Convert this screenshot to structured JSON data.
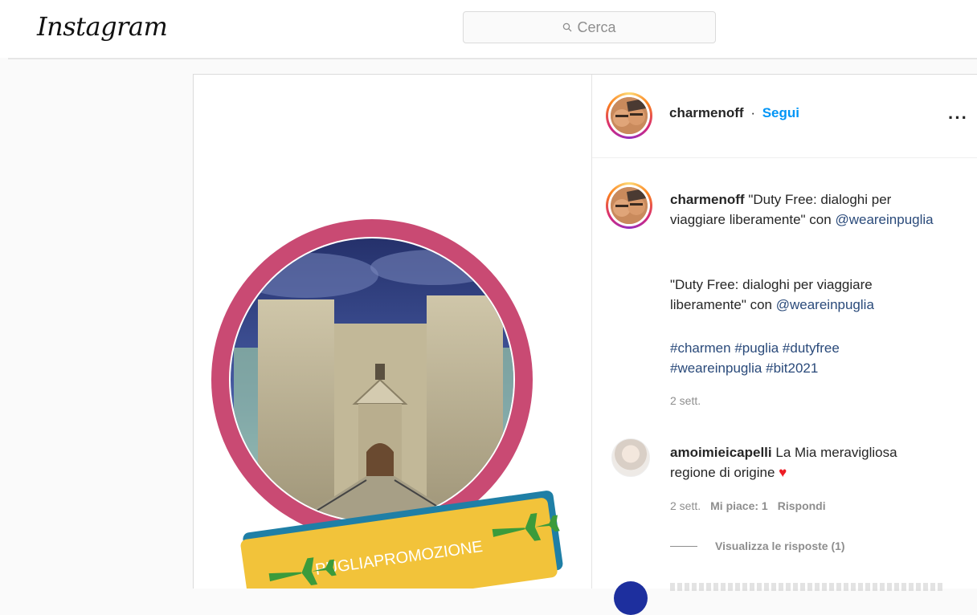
{
  "app": {
    "logo_text": "Instagram"
  },
  "search": {
    "placeholder": "Cerca",
    "icon": "search-icon"
  },
  "post": {
    "author": "charmenoff",
    "separator": "·",
    "follow_label": "Segui",
    "more_label": "···",
    "image": {
      "description_icon": "castel-del-monte-image",
      "banner_text": "PUGLIAPROMOZIONE",
      "banner_icons": [
        "airplane-icon",
        "airplane-icon"
      ],
      "colors": {
        "ring": "#c94a73",
        "banner": "#f2c33a",
        "banner_edge": "#1f7fa6",
        "plane": "#3b9b3b"
      }
    },
    "caption": {
      "user": "charmenoff",
      "text": "\"Duty Free: dialoghi per viaggiare liberamente\" con",
      "mention": "@weareinpuglia",
      "p2_text": "\"Duty Free: dialoghi per viaggiare liberamente\" con",
      "p2_mention": "@weareinpuglia",
      "hashtags": [
        "#charmen",
        "#puglia",
        "#dutyfree",
        "#weareinpuglia",
        "#bit2021"
      ],
      "time": "2 sett."
    },
    "comments": [
      {
        "user": "amoimieicapelli",
        "text": "La Mia meravigliosa regione di origine",
        "emoji": "❤️",
        "time": "2 sett.",
        "likes": "Mi piace: 1",
        "reply_label": "Rispondi",
        "view_replies": "Visualizza le risposte (1)"
      }
    ]
  },
  "colors": {
    "accent": "#0095f6",
    "link": "#2a4a7a",
    "muted": "#8e8e8e",
    "heart": "#ed1c24"
  }
}
